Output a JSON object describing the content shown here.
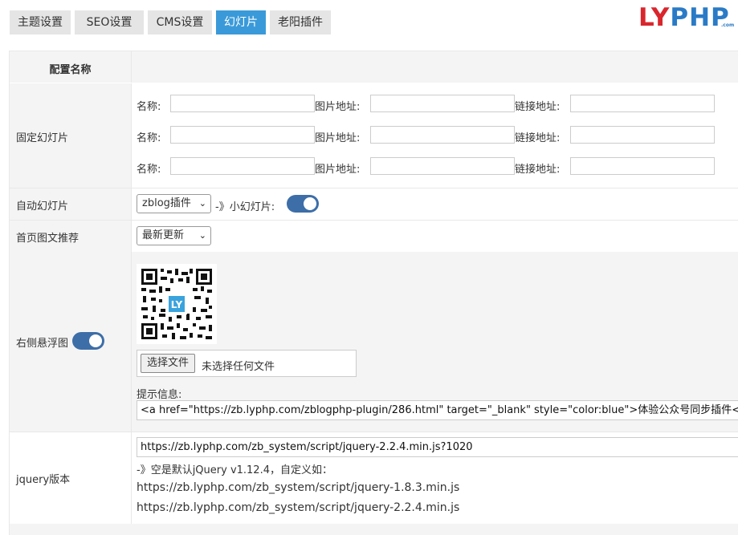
{
  "tabs": [
    {
      "label": "主题设置"
    },
    {
      "label": "SEO设置"
    },
    {
      "label": "CMS设置"
    },
    {
      "label": "幻灯片"
    },
    {
      "label": "老阳插件"
    }
  ],
  "logo": {
    "text_ly": "LY",
    "text_php": "PHP",
    "suffix": ".com"
  },
  "table": {
    "header": "配置名称",
    "fixed_slides": {
      "label": "固定幻灯片",
      "name_label": "名称:",
      "image_label": "图片地址:",
      "link_label": "链接地址:"
    },
    "auto_slides": {
      "label": "自动幻灯片",
      "select_value": "zblog插件",
      "mini_label": "-》小幻灯片:"
    },
    "home_recommend": {
      "label": "首页图文推荐",
      "select_value": "最新更新"
    },
    "float_image": {
      "label": "右侧悬浮图",
      "file_button": "选择文件",
      "file_status": "未选择任何文件",
      "tip_label": "提示信息:",
      "tip_value": "<a href=\"https://zb.lyphp.com/zblogphp-plugin/286.html\" target=\"_blank\" style=\"color:blue\">体验公众号同步插件</a>"
    },
    "jquery": {
      "label": "jquery版本",
      "value": "https://zb.lyphp.com/zb_system/script/jquery-2.2.4.min.js?1020",
      "note": "-》空是默认jQuery v1.12.4，自定义如：",
      "example1": "https://zb.lyphp.com/zb_system/script/jquery-1.8.3.min.js",
      "example2": "https://zb.lyphp.com/zb_system/script/jquery-2.2.4.min.js"
    }
  }
}
